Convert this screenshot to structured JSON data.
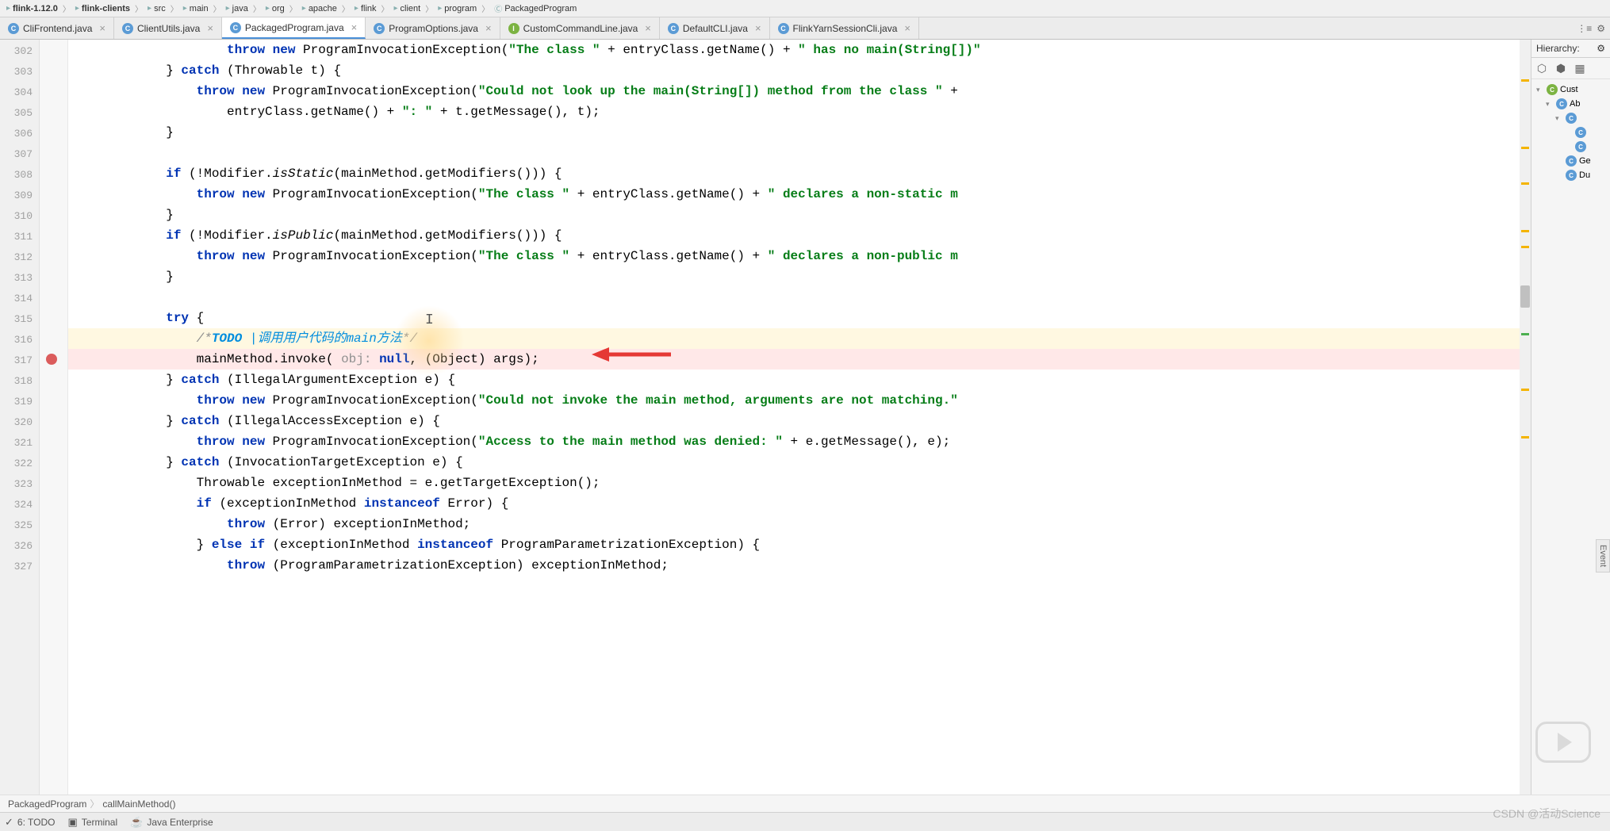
{
  "breadcrumb": {
    "items": [
      {
        "label": "flink-1.12.0",
        "bold": true
      },
      {
        "label": "flink-clients",
        "bold": true
      },
      {
        "label": "src"
      },
      {
        "label": "main"
      },
      {
        "label": "java"
      },
      {
        "label": "org"
      },
      {
        "label": "apache"
      },
      {
        "label": "flink"
      },
      {
        "label": "client"
      },
      {
        "label": "program"
      },
      {
        "label": "PackagedProgram",
        "type": "class"
      }
    ]
  },
  "tabs": {
    "items": [
      {
        "label": "CliFrontend.java",
        "icon": "c",
        "active": false
      },
      {
        "label": "ClientUtils.java",
        "icon": "c",
        "active": false
      },
      {
        "label": "PackagedProgram.java",
        "icon": "c",
        "active": true
      },
      {
        "label": "ProgramOptions.java",
        "icon": "c",
        "active": false
      },
      {
        "label": "CustomCommandLine.java",
        "icon": "i",
        "active": false
      },
      {
        "label": "DefaultCLI.java",
        "icon": "c",
        "active": false
      },
      {
        "label": "FlinkYarnSessionCli.java",
        "icon": "c",
        "active": false
      }
    ]
  },
  "gutter": {
    "start": 302,
    "end": 327,
    "breakpoints": [
      317
    ]
  },
  "code": {
    "lines": [
      {
        "n": 302,
        "segs": [
          {
            "t": "                    ",
            "c": ""
          },
          {
            "t": "throw new ",
            "c": "kw"
          },
          {
            "t": "ProgramInvocationException(",
            "c": ""
          },
          {
            "t": "\"The class \"",
            "c": "str"
          },
          {
            "t": " + entryClass.getName() + ",
            "c": ""
          },
          {
            "t": "\" has no main(String[])\"",
            "c": "str"
          }
        ]
      },
      {
        "n": 303,
        "segs": [
          {
            "t": "            } ",
            "c": ""
          },
          {
            "t": "catch ",
            "c": "kw"
          },
          {
            "t": "(Throwable t) {",
            "c": ""
          }
        ]
      },
      {
        "n": 304,
        "segs": [
          {
            "t": "                ",
            "c": ""
          },
          {
            "t": "throw new ",
            "c": "kw"
          },
          {
            "t": "ProgramInvocationException(",
            "c": ""
          },
          {
            "t": "\"Could not look up the main(String[]) method from the class \"",
            "c": "str"
          },
          {
            "t": " +",
            "c": ""
          }
        ]
      },
      {
        "n": 305,
        "segs": [
          {
            "t": "                    entryClass.getName() + ",
            "c": ""
          },
          {
            "t": "\": \"",
            "c": "str"
          },
          {
            "t": " + t.getMessage(), t);",
            "c": ""
          }
        ]
      },
      {
        "n": 306,
        "segs": [
          {
            "t": "            }",
            "c": ""
          }
        ]
      },
      {
        "n": 307,
        "segs": [
          {
            "t": "",
            "c": ""
          }
        ]
      },
      {
        "n": 308,
        "segs": [
          {
            "t": "            ",
            "c": ""
          },
          {
            "t": "if ",
            "c": "kw"
          },
          {
            "t": "(!Modifier.",
            "c": ""
          },
          {
            "t": "isStatic",
            "c": "method"
          },
          {
            "t": "(mainMethod.getModifiers())) {",
            "c": ""
          }
        ]
      },
      {
        "n": 309,
        "segs": [
          {
            "t": "                ",
            "c": ""
          },
          {
            "t": "throw new ",
            "c": "kw"
          },
          {
            "t": "ProgramInvocationException(",
            "c": ""
          },
          {
            "t": "\"The class \"",
            "c": "str"
          },
          {
            "t": " + entryClass.getName() + ",
            "c": ""
          },
          {
            "t": "\" declares a non-static m",
            "c": "str"
          }
        ]
      },
      {
        "n": 310,
        "segs": [
          {
            "t": "            }",
            "c": ""
          }
        ]
      },
      {
        "n": 311,
        "segs": [
          {
            "t": "            ",
            "c": ""
          },
          {
            "t": "if ",
            "c": "kw"
          },
          {
            "t": "(!Modifier.",
            "c": ""
          },
          {
            "t": "isPublic",
            "c": "method"
          },
          {
            "t": "(mainMethod.getModifiers())) {",
            "c": ""
          }
        ]
      },
      {
        "n": 312,
        "segs": [
          {
            "t": "                ",
            "c": ""
          },
          {
            "t": "throw new ",
            "c": "kw"
          },
          {
            "t": "ProgramInvocationException(",
            "c": ""
          },
          {
            "t": "\"The class \"",
            "c": "str"
          },
          {
            "t": " + entryClass.getName() + ",
            "c": ""
          },
          {
            "t": "\" declares a non-public m",
            "c": "str"
          }
        ]
      },
      {
        "n": 313,
        "segs": [
          {
            "t": "            }",
            "c": ""
          }
        ]
      },
      {
        "n": 314,
        "segs": [
          {
            "t": "",
            "c": ""
          }
        ]
      },
      {
        "n": 315,
        "segs": [
          {
            "t": "            ",
            "c": ""
          },
          {
            "t": "try ",
            "c": "kw"
          },
          {
            "t": "{",
            "c": ""
          }
        ]
      },
      {
        "n": 316,
        "hl": true,
        "segs": [
          {
            "t": "                ",
            "c": ""
          },
          {
            "t": "/*",
            "c": "com"
          },
          {
            "t": "TODO ",
            "c": "todo"
          },
          {
            "t": "|调用用户代码的main方法",
            "c": "todo-txt"
          },
          {
            "t": "*/",
            "c": "com"
          }
        ]
      },
      {
        "n": 317,
        "bp": true,
        "segs": [
          {
            "t": "                mainMethod.invoke( ",
            "c": ""
          },
          {
            "t": "obj: ",
            "c": "hint"
          },
          {
            "t": "null",
            "c": "kw"
          },
          {
            "t": ", (Object) args);",
            "c": ""
          }
        ]
      },
      {
        "n": 318,
        "segs": [
          {
            "t": "            } ",
            "c": ""
          },
          {
            "t": "catch ",
            "c": "kw"
          },
          {
            "t": "(IllegalArgumentException e) {",
            "c": ""
          }
        ]
      },
      {
        "n": 319,
        "segs": [
          {
            "t": "                ",
            "c": ""
          },
          {
            "t": "throw new ",
            "c": "kw"
          },
          {
            "t": "ProgramInvocationException(",
            "c": ""
          },
          {
            "t": "\"Could not invoke the main method, arguments are not matching.\"",
            "c": "str"
          }
        ]
      },
      {
        "n": 320,
        "segs": [
          {
            "t": "            } ",
            "c": ""
          },
          {
            "t": "catch ",
            "c": "kw"
          },
          {
            "t": "(IllegalAccessException e) {",
            "c": ""
          }
        ]
      },
      {
        "n": 321,
        "segs": [
          {
            "t": "                ",
            "c": ""
          },
          {
            "t": "throw new ",
            "c": "kw"
          },
          {
            "t": "ProgramInvocationException(",
            "c": ""
          },
          {
            "t": "\"Access to the main method was denied: \"",
            "c": "str"
          },
          {
            "t": " + e.getMessage(), e);",
            "c": ""
          }
        ]
      },
      {
        "n": 322,
        "segs": [
          {
            "t": "            } ",
            "c": ""
          },
          {
            "t": "catch ",
            "c": "kw"
          },
          {
            "t": "(InvocationTargetException e) {",
            "c": ""
          }
        ]
      },
      {
        "n": 323,
        "segs": [
          {
            "t": "                Throwable exceptionInMethod = e.getTargetException();",
            "c": ""
          }
        ]
      },
      {
        "n": 324,
        "segs": [
          {
            "t": "                ",
            "c": ""
          },
          {
            "t": "if ",
            "c": "kw"
          },
          {
            "t": "(exceptionInMethod ",
            "c": ""
          },
          {
            "t": "instanceof ",
            "c": "kw"
          },
          {
            "t": "Error) {",
            "c": ""
          }
        ]
      },
      {
        "n": 325,
        "segs": [
          {
            "t": "                    ",
            "c": ""
          },
          {
            "t": "throw ",
            "c": "kw"
          },
          {
            "t": "(Error) exceptionInMethod;",
            "c": ""
          }
        ]
      },
      {
        "n": 326,
        "segs": [
          {
            "t": "                } ",
            "c": ""
          },
          {
            "t": "else if ",
            "c": "kw"
          },
          {
            "t": "(exceptionInMethod ",
            "c": ""
          },
          {
            "t": "instanceof ",
            "c": "kw"
          },
          {
            "t": "ProgramParametrizationException) {",
            "c": ""
          }
        ]
      },
      {
        "n": 327,
        "segs": [
          {
            "t": "                    ",
            "c": ""
          },
          {
            "t": "throw ",
            "c": "kw"
          },
          {
            "t": "(ProgramParametrizationException) exceptionInMethod;",
            "c": ""
          }
        ]
      }
    ]
  },
  "hierarchy": {
    "title": "Hierarchy:",
    "items": [
      {
        "label": "Cust",
        "indent": 0,
        "icon": "c",
        "expand": true,
        "green": true
      },
      {
        "label": "Ab",
        "indent": 1,
        "icon": "c",
        "expand": true
      },
      {
        "label": "",
        "indent": 2,
        "icon": "c",
        "expand": true
      },
      {
        "label": "",
        "indent": 3,
        "icon": "c"
      },
      {
        "label": "",
        "indent": 3,
        "icon": "c"
      },
      {
        "label": "Ge",
        "indent": 2,
        "icon": "c"
      },
      {
        "label": "Du",
        "indent": 2,
        "icon": "c"
      }
    ]
  },
  "statusCrumb": {
    "items": [
      "PackagedProgram",
      "callMainMethod()"
    ]
  },
  "bottomBar": {
    "items": [
      {
        "icon": "✓",
        "label": "6: TODO"
      },
      {
        "icon": "▣",
        "label": "Terminal"
      },
      {
        "icon": "☕",
        "label": "Java Enterprise"
      }
    ]
  },
  "sideTab": "Event",
  "watermark": "CSDN @活动Science"
}
